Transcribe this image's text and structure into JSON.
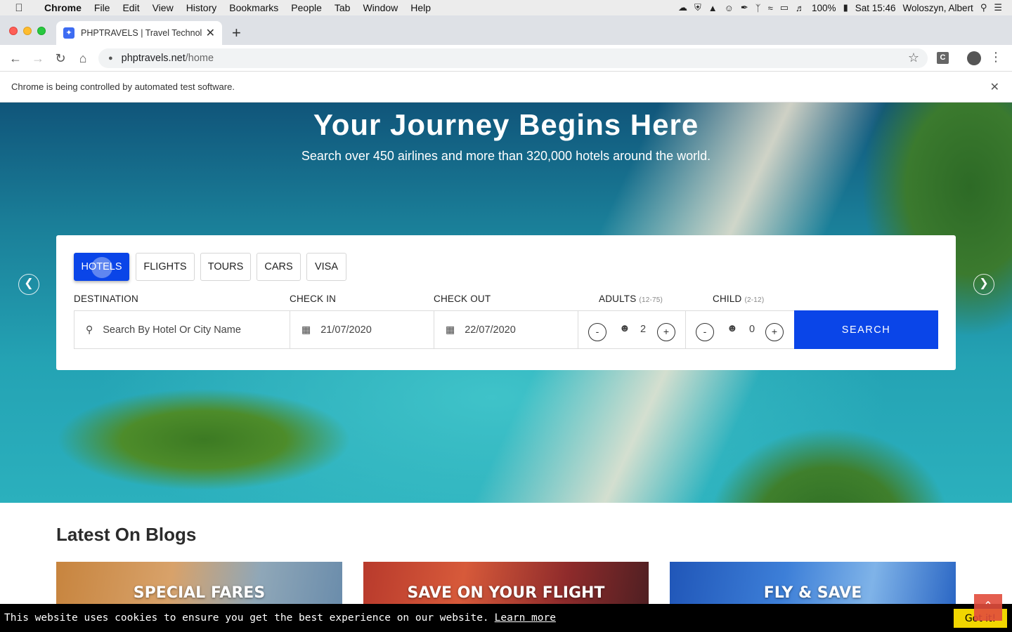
{
  "menubar": {
    "app_name": "Chrome",
    "items": [
      "File",
      "Edit",
      "View",
      "History",
      "Bookmarks",
      "People",
      "Tab",
      "Window",
      "Help"
    ],
    "battery": "100%",
    "clock": "Sat 15:46",
    "user": "Woloszyn, Albert"
  },
  "browser": {
    "tab_title": "PHPTRAVELS | Travel Technolo",
    "url_domain": "phptravels.net",
    "url_path": "/home",
    "infobar_text": "Chrome is being controlled by automated test software."
  },
  "hero": {
    "title": "Your Journey Begins Here",
    "subtitle": "Search over 450 airlines and more than 320,000 hotels around the world."
  },
  "search": {
    "tabs": [
      {
        "label": "HOTELS",
        "active": true
      },
      {
        "label": "FLIGHTS",
        "active": false
      },
      {
        "label": "TOURS",
        "active": false
      },
      {
        "label": "CARS",
        "active": false
      },
      {
        "label": "VISA",
        "active": false
      }
    ],
    "destination_label": "DESTINATION",
    "destination_placeholder": "Search By Hotel Or City Name",
    "checkin_label": "CHECK IN",
    "checkin_value": "21/07/2020",
    "checkout_label": "CHECK OUT",
    "checkout_value": "22/07/2020",
    "adults_label": "ADULTS",
    "adults_range": "(12-75)",
    "adults_value": "2",
    "child_label": "CHILD",
    "child_range": "(2-12)",
    "child_value": "0",
    "minus": "-",
    "plus": "+",
    "search_button": "SEARCH"
  },
  "blogs": {
    "title": "Latest On Blogs",
    "cards": [
      "SPECIAL FARES",
      "SAVE ON YOUR FLIGHT",
      "FLY & SAVE"
    ]
  },
  "cookie": {
    "text": "This website uses cookies to ensure you get the best experience on our website.",
    "learn_more": "Learn more",
    "accept": "Got it!"
  }
}
